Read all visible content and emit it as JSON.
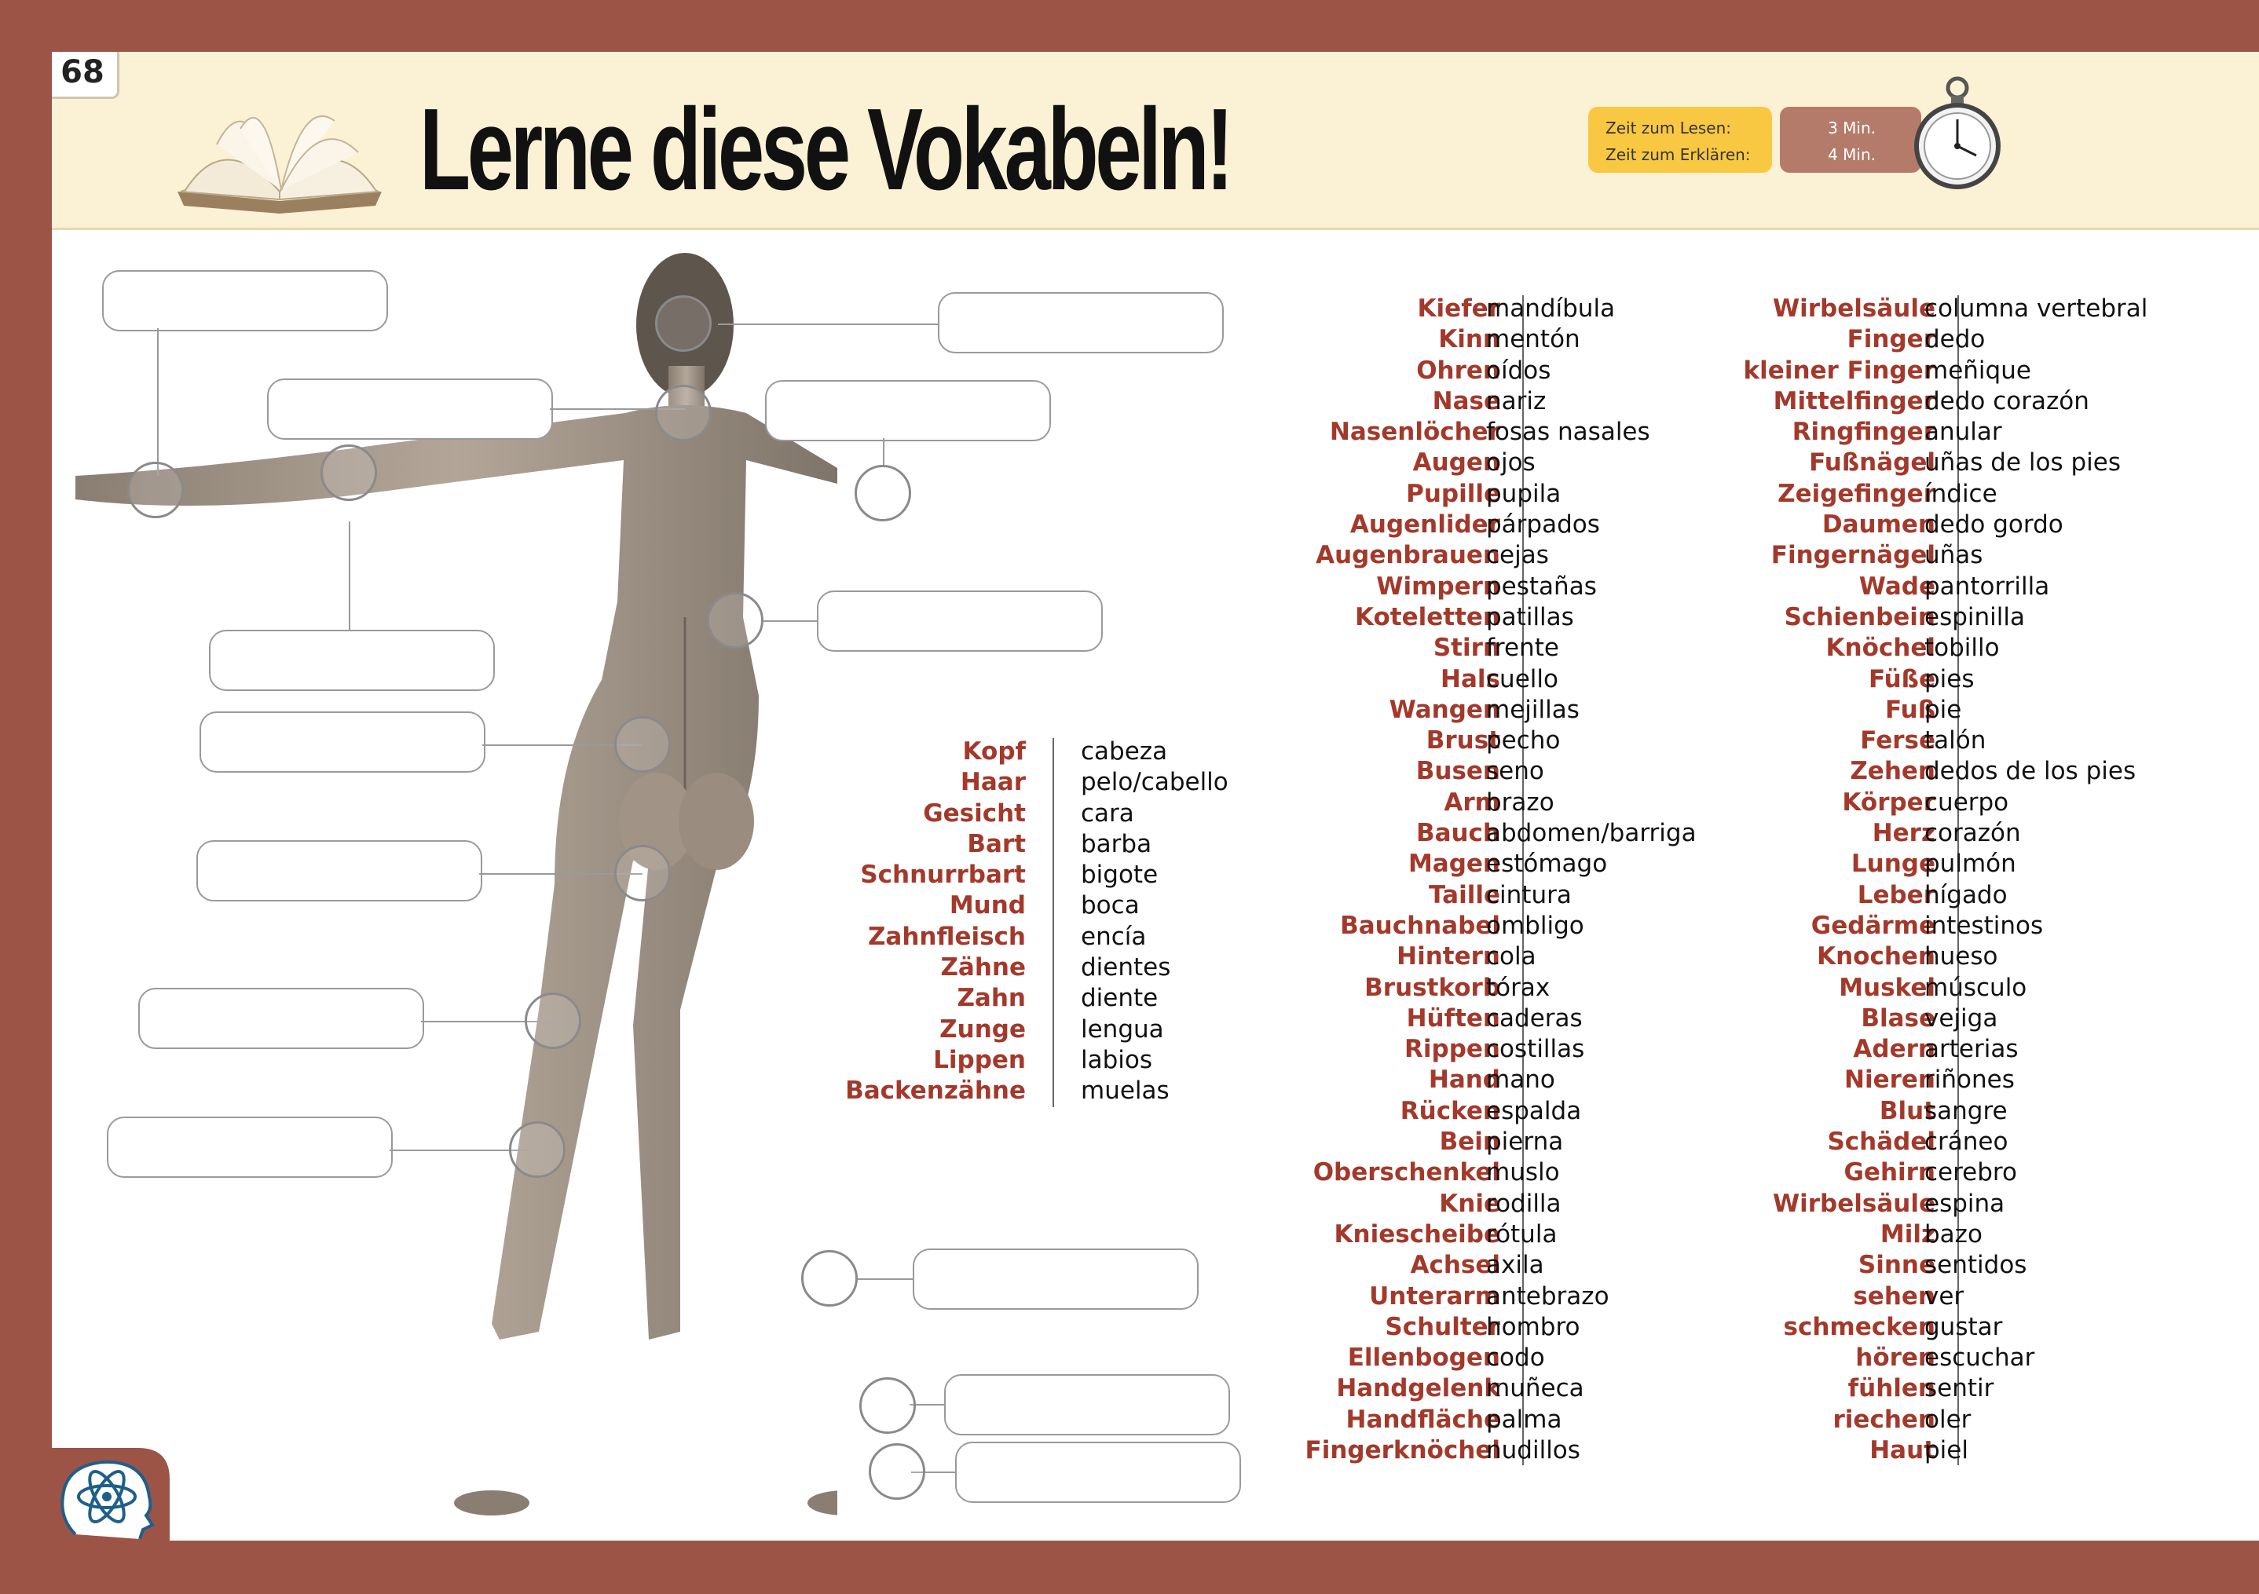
{
  "page_number": "68",
  "title": "Lerne diese Vokabeln!",
  "timer": {
    "read_label": "Zeit zum Lesen:",
    "explain_label": "Zeit zum Erklären:",
    "read_value": "3 Min.",
    "explain_value": "4 Min."
  },
  "colors": {
    "frame": "#9c5446",
    "header_bg": "#fbf1d4",
    "german_word": "#a3392b",
    "timer_label_bg": "#f9c842",
    "timer_value_bg": "#b57b6a",
    "logo": "#1e5f8a"
  },
  "icons": [
    "open-book-icon",
    "stopwatch-icon",
    "brain-atom-logo-icon"
  ],
  "figure": "human-body-back-view",
  "short_list": [
    {
      "de": "Kopf",
      "es": "cabeza"
    },
    {
      "de": "Haar",
      "es": "pelo/cabello"
    },
    {
      "de": "Gesicht",
      "es": "cara"
    },
    {
      "de": "Bart",
      "es": "barba"
    },
    {
      "de": "Schnurrbart",
      "es": "bigote"
    },
    {
      "de": "Mund",
      "es": "boca"
    },
    {
      "de": "Zahnfleisch",
      "es": "encía"
    },
    {
      "de": "Zähne",
      "es": "dientes"
    },
    {
      "de": "Zahn",
      "es": "diente"
    },
    {
      "de": "Zunge",
      "es": "lengua"
    },
    {
      "de": "Lippen",
      "es": "labios"
    },
    {
      "de": "Backenzähne",
      "es": "muelas"
    }
  ],
  "column_1": [
    {
      "de": "Kiefer",
      "es": "mandíbula"
    },
    {
      "de": "Kinn",
      "es": "mentón"
    },
    {
      "de": "Ohren",
      "es": "oídos"
    },
    {
      "de": "Nase",
      "es": "nariz"
    },
    {
      "de": "Nasenlöcher",
      "es": "fosas nasales"
    },
    {
      "de": "Augen",
      "es": "ojos"
    },
    {
      "de": "Pupille",
      "es": "pupila"
    },
    {
      "de": "Augenlider",
      "es": "párpados"
    },
    {
      "de": "Augenbrauen",
      "es": "cejas"
    },
    {
      "de": "Wimpern",
      "es": "pestañas"
    },
    {
      "de": "Koteletten",
      "es": "patillas"
    },
    {
      "de": "Stirn",
      "es": "frente"
    },
    {
      "de": "Hals",
      "es": "cuello"
    },
    {
      "de": "Wangen",
      "es": "mejillas"
    },
    {
      "de": "Brust",
      "es": "pecho"
    },
    {
      "de": "Busen",
      "es": "seno"
    },
    {
      "de": "Arm",
      "es": "brazo"
    },
    {
      "de": "Bauch",
      "es": "abdomen/barriga"
    },
    {
      "de": "Magen",
      "es": "estómago"
    },
    {
      "de": "Taille",
      "es": "cintura"
    },
    {
      "de": "Bauchnabel",
      "es": "ombligo"
    },
    {
      "de": "Hintern",
      "es": "cola"
    },
    {
      "de": "Brustkorb",
      "es": "tórax"
    },
    {
      "de": "Hüften",
      "es": "caderas"
    },
    {
      "de": "Rippen",
      "es": "costillas"
    },
    {
      "de": "Hand",
      "es": "mano"
    },
    {
      "de": "Rücken",
      "es": "espalda"
    },
    {
      "de": "Bein",
      "es": "pierna"
    },
    {
      "de": "Oberschenkel",
      "es": "muslo"
    },
    {
      "de": "Knie",
      "es": "rodilla"
    },
    {
      "de": "Kniescheibe",
      "es": "rótula"
    },
    {
      "de": "Achsel",
      "es": "axila"
    },
    {
      "de": "Unterarm",
      "es": "antebrazo"
    },
    {
      "de": "Schulter",
      "es": "hombro"
    },
    {
      "de": "Ellenbogen",
      "es": "codo"
    },
    {
      "de": "Handgelenk",
      "es": "muñeca"
    },
    {
      "de": "Handfläche",
      "es": "palma"
    },
    {
      "de": "Fingerknöchel",
      "es": "nudillos"
    }
  ],
  "column_2": [
    {
      "de": "Wirbelsäule",
      "es": "columna vertebral"
    },
    {
      "de": "Finger",
      "es": "dedo"
    },
    {
      "de": "kleiner Finger",
      "es": "meñique"
    },
    {
      "de": "Mittelfinger",
      "es": "dedo corazón"
    },
    {
      "de": "Ringfinger",
      "es": "anular"
    },
    {
      "de": "Fußnägel",
      "es": "uñas de los pies"
    },
    {
      "de": "Zeigefinger",
      "es": "índice"
    },
    {
      "de": "Daumen",
      "es": "dedo gordo"
    },
    {
      "de": "Fingernägel",
      "es": "uñas"
    },
    {
      "de": "Wade",
      "es": "pantorrilla"
    },
    {
      "de": "Schienbein",
      "es": "espinilla"
    },
    {
      "de": "Knöchel",
      "es": "tobillo"
    },
    {
      "de": "Füße",
      "es": "pies"
    },
    {
      "de": "Fuß",
      "es": "pie"
    },
    {
      "de": "Ferse",
      "es": "talón"
    },
    {
      "de": "Zehen",
      "es": "dedos de los pies"
    },
    {
      "de": "Körper",
      "es": "cuerpo"
    },
    {
      "de": "Herz",
      "es": "corazón"
    },
    {
      "de": "Lunge",
      "es": "pulmón"
    },
    {
      "de": "Leber",
      "es": "hígado"
    },
    {
      "de": "Gedärme",
      "es": "intestinos"
    },
    {
      "de": "Knochen",
      "es": "hueso"
    },
    {
      "de": "Muskel",
      "es": "músculo"
    },
    {
      "de": "Blase",
      "es": "vejiga"
    },
    {
      "de": "Adern",
      "es": "arterias"
    },
    {
      "de": "Nieren",
      "es": "riñones"
    },
    {
      "de": "Blut",
      "es": "sangre"
    },
    {
      "de": "Schädel",
      "es": "cráneo"
    },
    {
      "de": "Gehirn",
      "es": "cerebro"
    },
    {
      "de": "Wirbelsäule",
      "es": "espina"
    },
    {
      "de": "Milz",
      "es": "bazo"
    },
    {
      "de": "Sinne",
      "es": "sentidos"
    },
    {
      "de": "sehen",
      "es": "ver"
    },
    {
      "de": "schmecken",
      "es": "gustar"
    },
    {
      "de": "hören",
      "es": "escuchar"
    },
    {
      "de": "fühlen",
      "es": "sentir"
    },
    {
      "de": "riechen",
      "es": "oler"
    },
    {
      "de": "Haut",
      "es": "piel"
    }
  ]
}
